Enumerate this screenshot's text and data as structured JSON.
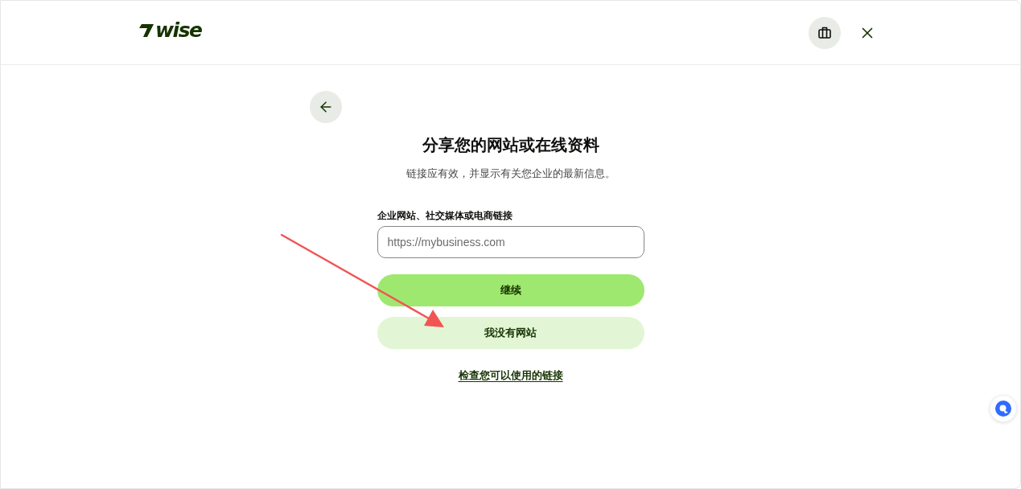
{
  "header": {
    "logo": "wise"
  },
  "page": {
    "title": "分享您的网站或在线资料",
    "subtitle": "链接应有效，并显示有关您企业的最新信息。"
  },
  "form": {
    "field": {
      "label": "企业网站、社交媒体或电商链接",
      "placeholder": "https://mybusiness.com"
    },
    "buttons": [
      {
        "label": "继续",
        "kind": "primary"
      },
      {
        "label": "我没有网站",
        "kind": "secondary"
      }
    ],
    "link": "检查您可以使用的链接"
  }
}
